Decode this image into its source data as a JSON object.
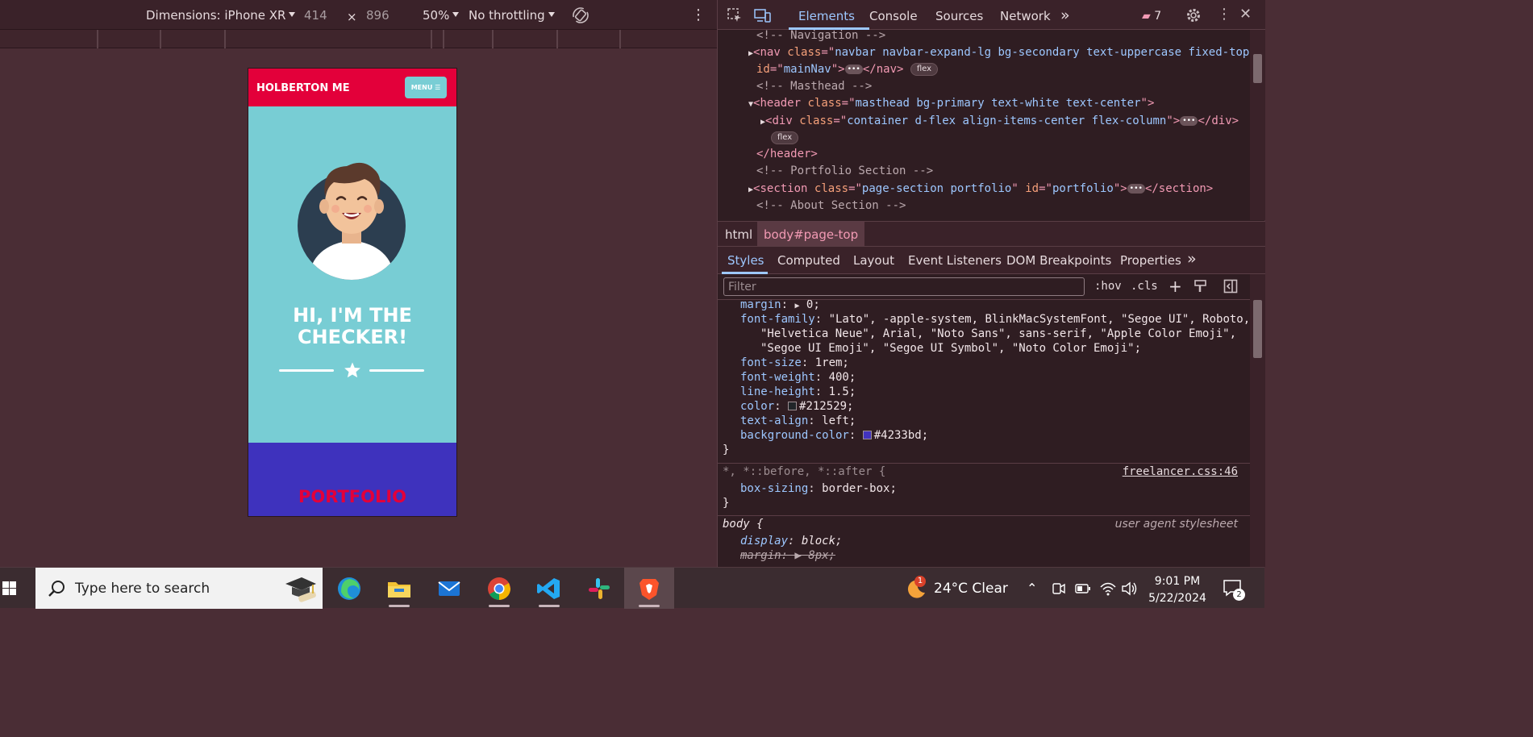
{
  "device_toolbar": {
    "dimensions_label": "Dimensions: iPhone XR",
    "width": "414",
    "times": "×",
    "height": "896",
    "zoom": "50%",
    "throttling": "No throttling"
  },
  "phone_page": {
    "brand": "HOLBERTON ME",
    "menu_label": "MENU",
    "hero_line1": "HI, I'M THE",
    "hero_line2": "CHECKER!",
    "portfolio_heading": "PORTFOLIO",
    "colors": {
      "nav": "#e3003a",
      "masthead": "#78cdd4",
      "section": "#3e32bd"
    }
  },
  "devtools": {
    "tabs": [
      "Elements",
      "Console",
      "Sources",
      "Network"
    ],
    "more": "»",
    "issues_count": "7",
    "dom": {
      "c_navigation": "<!-- Navigation -->",
      "nav_class": "navbar navbar-expand-lg bg-secondary text-uppercase fixed-top",
      "nav_id": "mainNav",
      "flex": "flex",
      "c_masthead": "<!-- Masthead -->",
      "header_class": "masthead bg-primary text-white text-center",
      "div_class": "container d-flex align-items-center flex-column",
      "c_portfolio": "<!-- Portfolio Section -->",
      "section_class": "page-section portfolio",
      "section_id": "portfolio",
      "c_about": "<!-- About Section -->"
    },
    "breadcrumb": [
      "html",
      "body#page-top"
    ],
    "style_tabs": [
      "Styles",
      "Computed",
      "Layout",
      "Event Listeners",
      "DOM Breakpoints",
      "Properties"
    ],
    "filter_placeholder": "Filter",
    "hov": ":hov",
    "cls": ".cls",
    "css": {
      "margin": "0;",
      "font_family_1": "\"Lato\", -apple-system, BlinkMacSystemFont, \"Segoe UI\", Roboto,",
      "font_family_2": "\"Helvetica Neue\", Arial, \"Noto Sans\", sans-serif, \"Apple Color Emoji\",",
      "font_family_3": "\"Segoe UI Emoji\", \"Segoe UI Symbol\", \"Noto Color Emoji\";",
      "font_size": "1rem;",
      "font_weight": "400;",
      "line_height": "1.5;",
      "color": "#212529;",
      "text_align": "left;",
      "background_color": "#4233bd;",
      "universal_selector": "*, *::before, *::after {",
      "universal_source": "freelancer.css:46",
      "box_sizing": "border-box;",
      "body_selector": "body {",
      "ua_label": "user agent stylesheet",
      "display": "block;",
      "margin_ua": "8px;"
    }
  },
  "taskbar": {
    "search_placeholder": "Type here to search",
    "weather": "24°C  Clear",
    "weather_badge": "1",
    "time": "9:01 PM",
    "date": "5/22/2024",
    "notifications": "2"
  }
}
